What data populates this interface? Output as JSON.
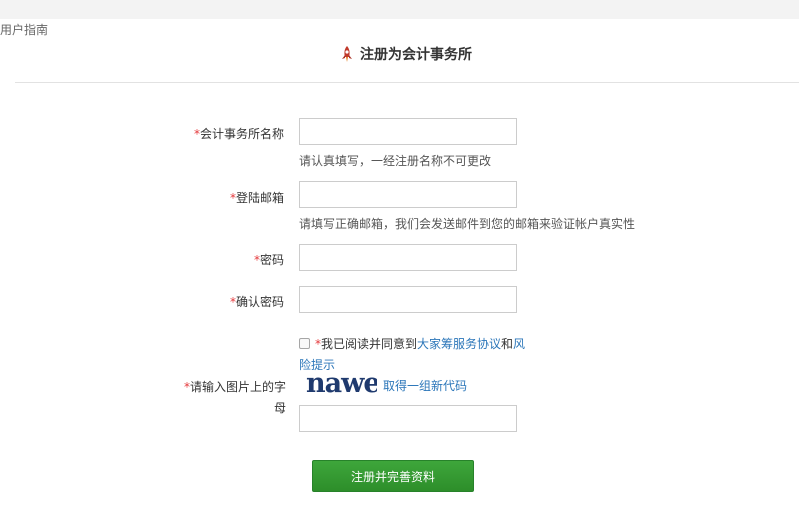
{
  "guide_link": "用户指南",
  "header": {
    "title": "注册为会计事务所",
    "icon": "rocket-icon"
  },
  "form": {
    "required_mark": "*",
    "firm_name": {
      "label": "会计事务所名称",
      "value": "",
      "hint": "请认真填写，一经注册名称不可更改"
    },
    "email": {
      "label": "登陆邮箱",
      "value": "",
      "hint": "请填写正确邮箱，我们会发送邮件到您的邮箱来验证帐户真实性"
    },
    "password": {
      "label": "密码",
      "value": ""
    },
    "confirm_password": {
      "label": "确认密码",
      "value": ""
    },
    "agreement": {
      "checked": false,
      "prefix": "我已阅读并同意到",
      "service_link": "大家筹服务协议",
      "conjunction": "和",
      "risk_link": "风险提示"
    },
    "captcha": {
      "label": "请输入图片上的字母",
      "image_text": "nawe",
      "refresh_link": "取得一组新代码",
      "value": ""
    },
    "submit_label": "注册并完善资料"
  },
  "colors": {
    "accent_green": "#2d8e2a",
    "link_blue": "#2b76b9",
    "required_red": "#e4393c"
  }
}
